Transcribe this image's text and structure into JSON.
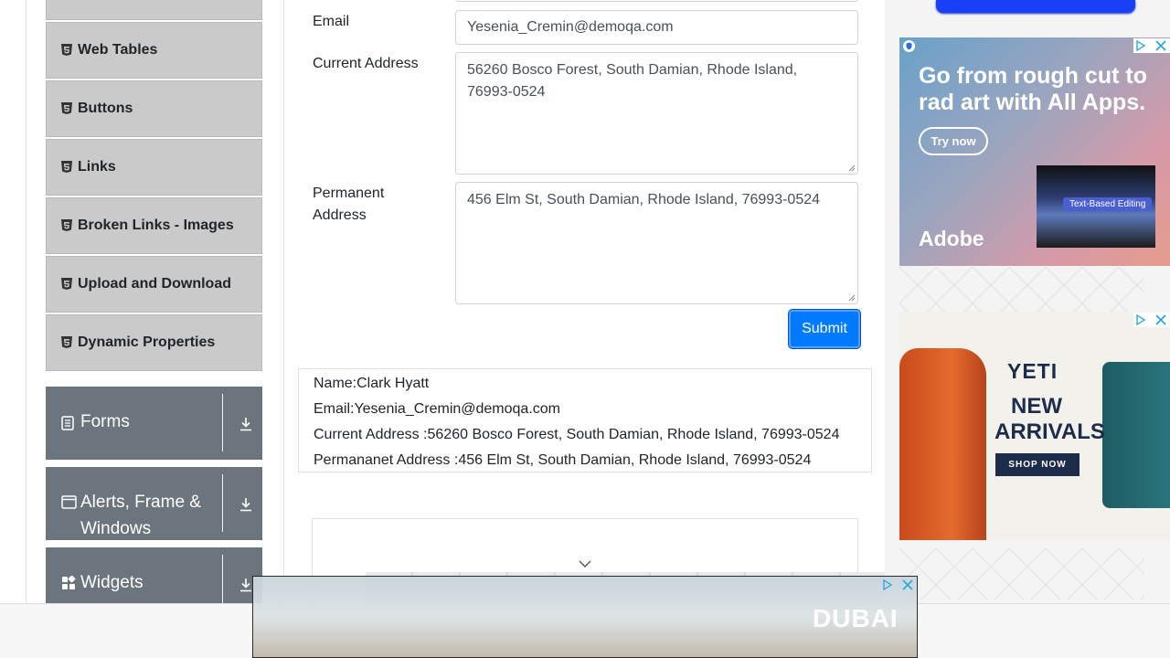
{
  "sidebar": {
    "elements_items": [
      {
        "label": ""
      },
      {
        "label": "Web Tables"
      },
      {
        "label": "Buttons"
      },
      {
        "label": "Links"
      },
      {
        "label": "Broken Links - Images"
      },
      {
        "label": "Upload and Download"
      },
      {
        "label": "Dynamic Properties"
      }
    ],
    "groups": [
      {
        "label": "Forms"
      },
      {
        "label": "Alerts, Frame & Windows"
      },
      {
        "label": "Widgets"
      }
    ]
  },
  "form": {
    "email_label": "Email",
    "email_value": "Yesenia_Cremin@demoqa.com",
    "current_address_label": "Current Address",
    "current_address_value": "56260 Bosco Forest, South Damian, Rhode Island, 76993-0524",
    "permanent_address_label": "Permanent Address",
    "permanent_address_value": "456 Elm St, South Damian, Rhode Island, 76993-0524",
    "submit_label": "Submit"
  },
  "output": {
    "name": "Name:Clark Hyatt",
    "email": "Email:Yesenia_Cremin@demoqa.com",
    "current_address": "Current Address :56260 Bosco Forest, South Damian, Rhode Island, 76993-0524",
    "permanent_address": "Permananet Address :456 Elm St, South Damian, Rhode Island, 76993-0524"
  },
  "ads": {
    "adobe": {
      "headline": "Go from rough cut to rad art with All Apps.",
      "cta": "Try now",
      "brand": "Adobe",
      "tag": "Text-Based Editing"
    },
    "yeti": {
      "brand": "YETI",
      "headline": "NEW ARRIVALS",
      "cta": "SHOP NOW"
    },
    "bottom": {
      "brand": "DUBAI"
    }
  },
  "colors": {
    "accent": "#007bff",
    "sidebar_item_bg": "#cacaca",
    "sidebar_group_bg": "#6c757d"
  }
}
